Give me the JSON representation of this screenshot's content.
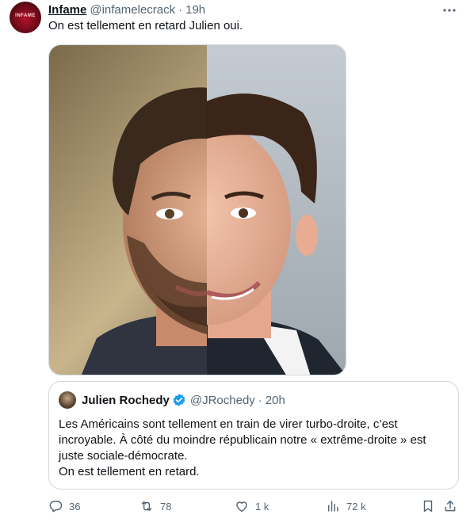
{
  "tweet": {
    "author": {
      "display_name": "Infame",
      "handle": "@infamelecrack",
      "avatar_text": "INFAME"
    },
    "separator": "·",
    "time": "19h",
    "text": "On est tellement en retard Julien oui."
  },
  "quote": {
    "author": {
      "display_name": "Julien Rochedy",
      "handle": "@JRochedy",
      "verified": true
    },
    "separator": "·",
    "time": "20h",
    "text_lines": [
      "Les Américains sont tellement en train de virer turbo-droite, c’est",
      "incroyable. À côté du moindre républicain notre « extrême-droite » est",
      "juste sociale-démocrate.",
      "On est tellement en retard."
    ]
  },
  "actions": {
    "replies": "36",
    "reposts": "78",
    "likes": "1 k",
    "views": "72 k"
  },
  "colors": {
    "text": "#0f1419",
    "secondary": "#536471",
    "border": "#cfd9de",
    "verified": "#1d9bf0"
  }
}
